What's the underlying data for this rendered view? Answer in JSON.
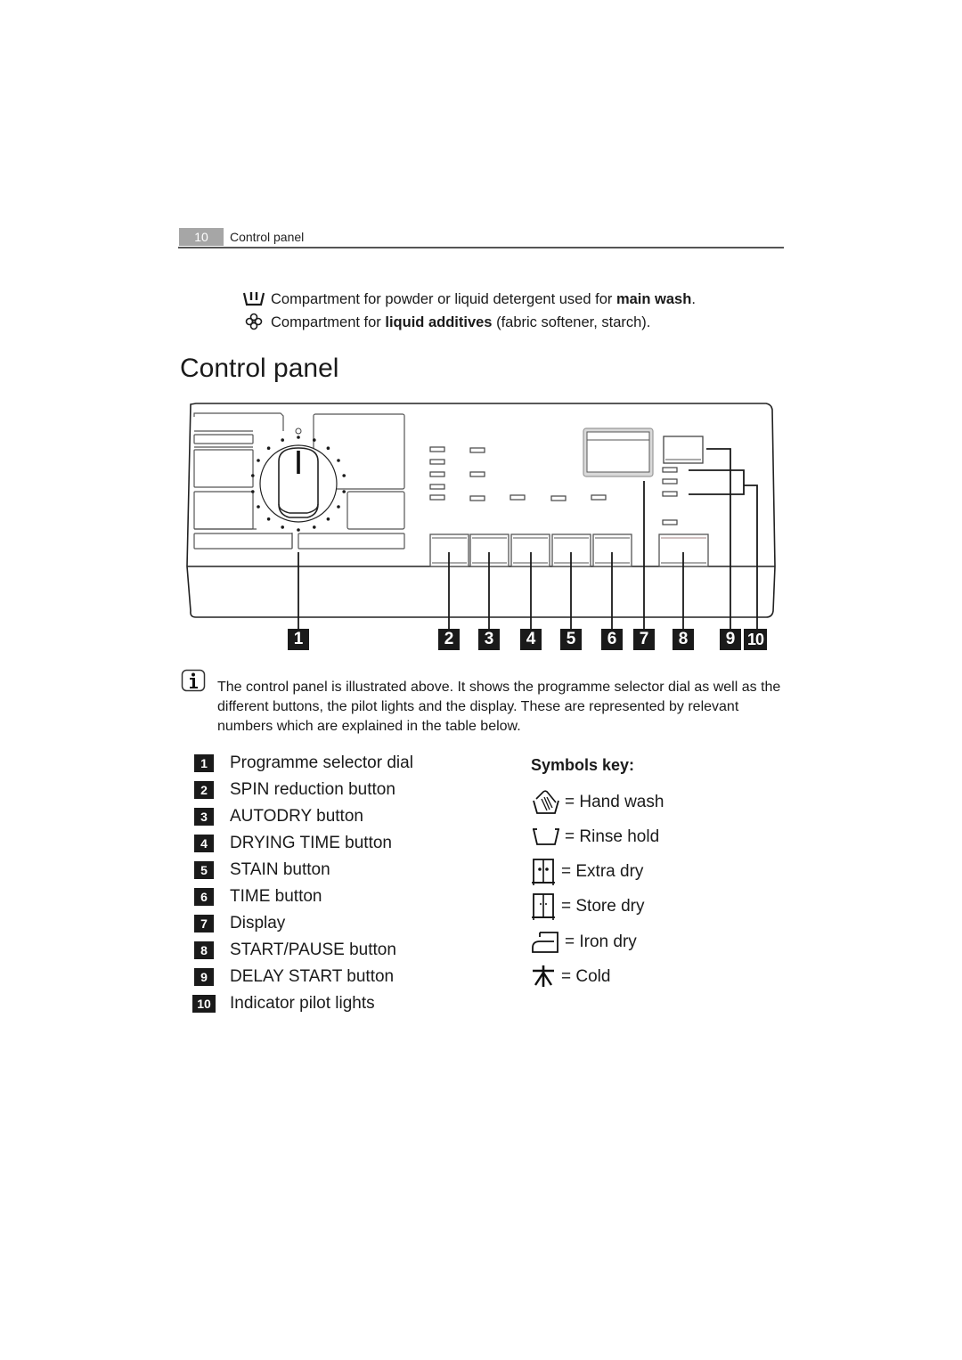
{
  "header": {
    "page_number": "10",
    "section": "Control panel"
  },
  "compartments": [
    {
      "icon": "main-wash-icon",
      "prefix": "Compartment for powder or liquid detergent used for ",
      "bold": "main wash",
      "suffix": "."
    },
    {
      "icon": "flower-icon",
      "prefix": "Compartment for ",
      "bold": "liquid additives",
      "suffix": " (fabric softener, starch)."
    }
  ],
  "title": "Control panel",
  "diagram": {
    "callouts": [
      "1",
      "2",
      "3",
      "4",
      "5",
      "6",
      "7",
      "8",
      "9",
      "10"
    ]
  },
  "info": {
    "icon": "info-icon",
    "text": "The control panel is illustrated above. It shows the programme selector dial as well as the different buttons, the pilot lights and the display. These are represented by relevant numbers which are explained in the table below."
  },
  "legend": [
    {
      "number": "1",
      "label": "Programme selector dial"
    },
    {
      "number": "2",
      "label": "SPIN reduction button"
    },
    {
      "number": "3",
      "label": "AUTODRY button"
    },
    {
      "number": "4",
      "label": "DRYING TIME button"
    },
    {
      "number": "5",
      "label": "STAIN button"
    },
    {
      "number": "6",
      "label": "TIME button"
    },
    {
      "number": "7",
      "label": "Display"
    },
    {
      "number": "8",
      "label": "START/PAUSE button"
    },
    {
      "number": "9",
      "label": "DELAY START button"
    },
    {
      "number": "10",
      "label": "Indicator pilot lights"
    }
  ],
  "symbols": {
    "title": "Symbols key:",
    "items": [
      {
        "icon": "hand-wash-icon",
        "label": "= Hand wash"
      },
      {
        "icon": "rinse-hold-icon",
        "label": "= Rinse hold"
      },
      {
        "icon": "extra-dry-icon",
        "label": "= Extra dry"
      },
      {
        "icon": "store-dry-icon",
        "label": "= Store dry"
      },
      {
        "icon": "iron-dry-icon",
        "label": "= Iron dry"
      },
      {
        "icon": "cold-icon",
        "label": "= Cold"
      }
    ]
  }
}
